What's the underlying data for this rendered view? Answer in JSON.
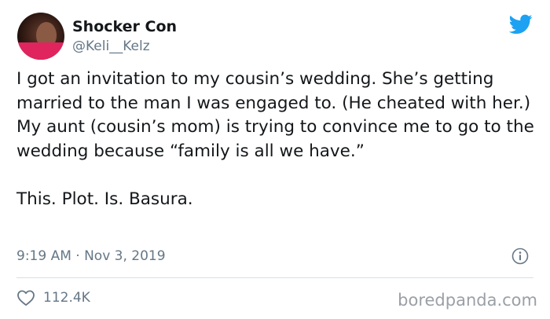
{
  "user": {
    "display_name": "Shocker Con",
    "handle": "@Keli__Kelz"
  },
  "tweet": {
    "text": "I got an invitation to my cousin’s wedding. She’s getting married to the man I was engaged to. (He cheated with her.) My aunt (cousin’s mom) is trying to convince me to go to the wedding because “family is all we have.”\n\nThis. Plot. Is. Basura.",
    "timestamp": "9:19 AM · Nov 3, 2019",
    "like_count": "112.4K"
  },
  "watermark": "boredpanda.com",
  "icons": {
    "brand": "twitter-bird-icon",
    "info": "info-icon",
    "like": "heart-icon"
  },
  "colors": {
    "twitter_blue": "#1da1f2",
    "secondary_text": "#657786",
    "primary_text": "#14171a"
  }
}
